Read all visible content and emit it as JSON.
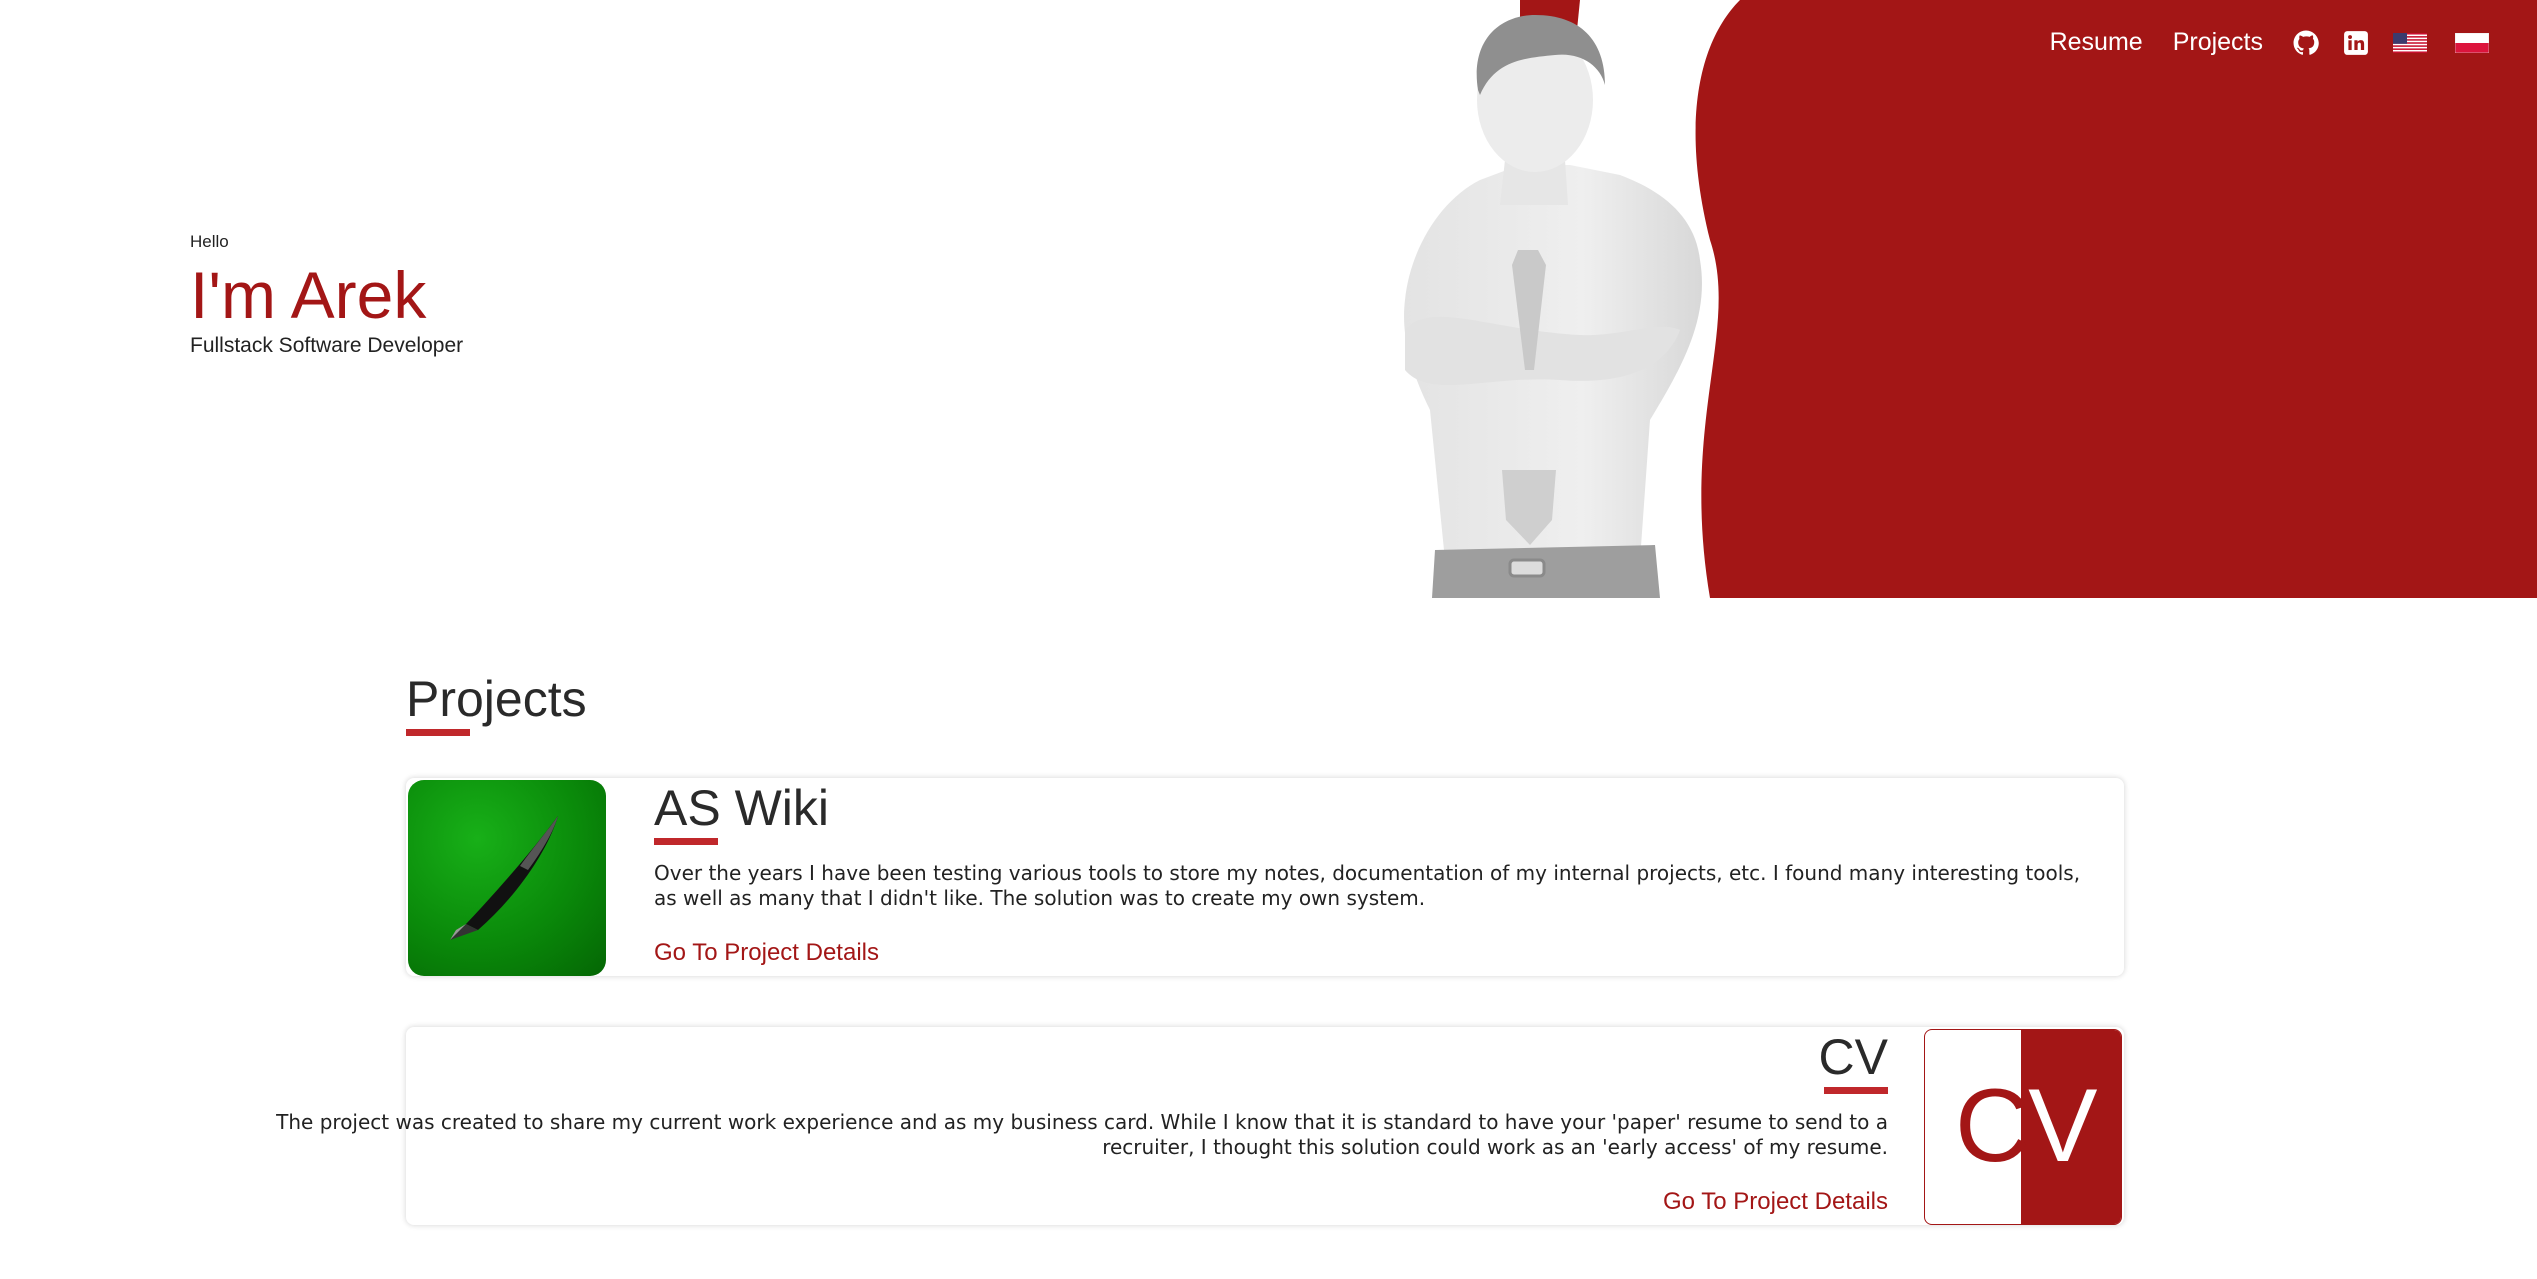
{
  "nav": {
    "resume_label": "Resume",
    "projects_label": "Projects",
    "icons": [
      "github-icon",
      "linkedin-icon",
      "flag-us-icon",
      "flag-pl-icon"
    ]
  },
  "hero": {
    "greeting": "Hello",
    "name": "I'm Arek",
    "role": "Fullstack Software Developer",
    "accent_color": "#a31616"
  },
  "projects": {
    "title": "Projects",
    "items": [
      {
        "title": "AS Wiki",
        "description": "Over the years I have been testing various tools to store my notes, documentation of my internal projects, etc. I found many interesting tools, as well as many that I didn't like. The solution was to create my own system.",
        "link_label": "Go To Project Details",
        "icon": "pen-icon"
      },
      {
        "title": "CV",
        "description": "The project was created to share my current work experience and as my business card. While I know that it is standard to have your 'paper' resume to send to a recruiter, I thought this solution could work as an 'early access' of my resume.",
        "link_label": "Go To Project Details",
        "thumb_text_1": "C",
        "thumb_text_2": "V"
      }
    ]
  }
}
